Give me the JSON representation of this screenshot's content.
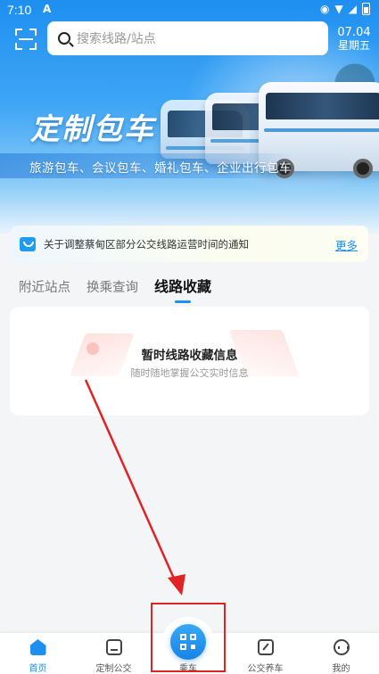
{
  "status_bar": {
    "time": "7:10",
    "notification_glyph": "A"
  },
  "search": {
    "placeholder": "搜索线路/站点"
  },
  "date": {
    "month_day": "07.04",
    "weekday": "星期五"
  },
  "banner": {
    "title": "定制包车",
    "subtitle": "旅游包车、会议包车、婚礼包车、企业出行包车"
  },
  "notice": {
    "text": "关于调整蔡甸区部分公交线路运营时间的通知",
    "more_label": "更多"
  },
  "tabs": [
    {
      "label": "附近站点",
      "active": false
    },
    {
      "label": "换乘查询",
      "active": false
    },
    {
      "label": "线路收藏",
      "active": true
    }
  ],
  "empty_state": {
    "title": "暂时线路收藏信息",
    "subtitle": "随时随地掌握公交实时信息"
  },
  "bottom_nav": [
    {
      "label": "首页",
      "icon": "home-icon",
      "active": true
    },
    {
      "label": "定制公交",
      "icon": "bus-icon",
      "active": false
    },
    {
      "label": "乘车",
      "icon": "qr-code-icon",
      "active": false
    },
    {
      "label": "公交养车",
      "icon": "maintenance-icon",
      "active": false
    },
    {
      "label": "我的",
      "icon": "profile-icon",
      "active": false
    }
  ],
  "colors": {
    "accent": "#1e8ff0",
    "annotation": "#e02424"
  }
}
